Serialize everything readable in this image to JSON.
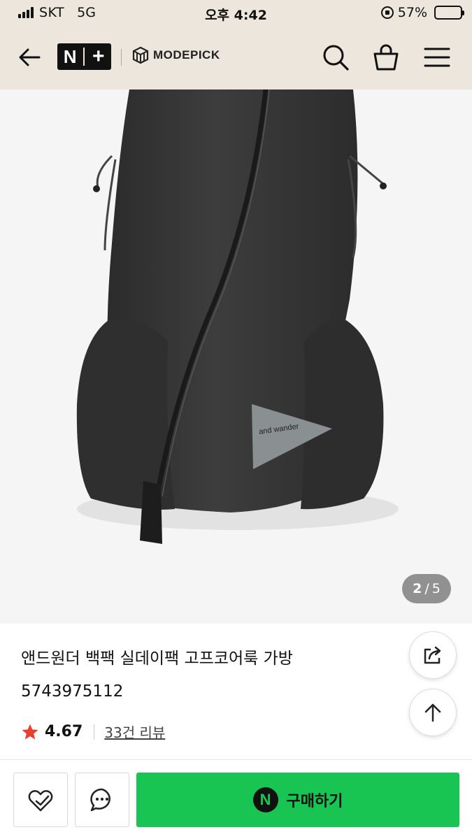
{
  "status_bar": {
    "carrier": "SKT",
    "network": "5G",
    "time": "오후 4:42",
    "battery_text": "57%",
    "battery_level": 0.57
  },
  "header": {
    "logo_main": "N+",
    "logo_secondary": "MODEPICK",
    "icons": [
      "back-arrow-icon",
      "search-icon",
      "cart-icon",
      "menu-icon"
    ]
  },
  "product_image": {
    "bag_print": "and wander",
    "counter_current": "2",
    "counter_separator": "/",
    "counter_total": "5"
  },
  "product": {
    "title": "앤드원더 백팩 실데이팩 고프코어룩 가방",
    "code": "5743975112",
    "rating": "4.67",
    "review_link": "33건 리뷰",
    "star_color": "#e8402e"
  },
  "bottom_bar": {
    "buy_label": "구매하기",
    "pay_badge": "N",
    "buy_color": "#19c552"
  }
}
